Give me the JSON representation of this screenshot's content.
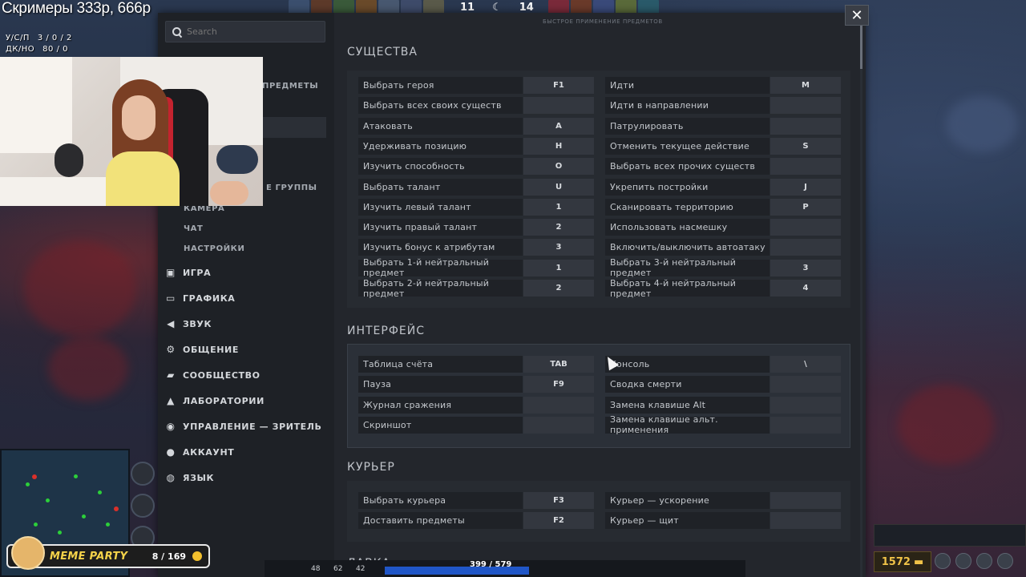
{
  "stream": {
    "title": "Скримеры 333р, 666р",
    "kda_label": "У/С/П",
    "kda_value": "3 / 0 / 2",
    "lhdn_label": "ДК/НО",
    "lhdn_value": "80 / 0"
  },
  "top_hud": {
    "radiant_score": "11",
    "dire_score": "14"
  },
  "settings": {
    "search_placeholder": "Search",
    "sidebar_sub": {
      "items_partial": "ПРЕДМЕТЫ",
      "groups_partial": "Е ГРУППЫ",
      "camera": "КАМЕРА",
      "chat": "ЧАТ",
      "settings": "НАСТРОЙКИ"
    },
    "nav": [
      {
        "label": "ИГРА",
        "icon": "game-icon"
      },
      {
        "label": "ГРАФИКА",
        "icon": "monitor-icon"
      },
      {
        "label": "ЗВУК",
        "icon": "speaker-icon"
      },
      {
        "label": "ОБЩЕНИЕ",
        "icon": "gear-icon"
      },
      {
        "label": "СООБЩЕСТВО",
        "icon": "chat-bubble-icon"
      },
      {
        "label": "ЛАБОРАТОРИИ",
        "icon": "flask-icon"
      },
      {
        "label": "УПРАВЛЕНИЕ — ЗРИТЕЛЬ",
        "icon": "eye-icon"
      },
      {
        "label": "АККАУНТ",
        "icon": "user-icon"
      },
      {
        "label": "ЯЗЫК",
        "icon": "globe-icon"
      }
    ],
    "top_caption": "БЫСТРОЕ ПРИМЕНЕНИЕ ПРЕДМЕТОВ",
    "sections": {
      "units": {
        "title": "СУЩЕСТВА",
        "left": [
          {
            "label": "Выбрать героя",
            "key": "F1"
          },
          {
            "label": "Выбрать всех своих существ",
            "key": ""
          },
          {
            "label": "Атаковать",
            "key": "A"
          },
          {
            "label": "Удерживать позицию",
            "key": "H"
          },
          {
            "label": "Изучить способность",
            "key": "O"
          },
          {
            "label": "Выбрать талант",
            "key": "U"
          },
          {
            "label": "Изучить левый талант",
            "key": "1"
          },
          {
            "label": "Изучить правый талант",
            "key": "2"
          },
          {
            "label": "Изучить бонус к атрибутам",
            "key": "3"
          },
          {
            "label": "Выбрать 1-й нейтральный предмет",
            "key": "1"
          },
          {
            "label": "Выбрать 2-й нейтральный предмет",
            "key": "2"
          }
        ],
        "right": [
          {
            "label": "Идти",
            "key": "M"
          },
          {
            "label": "Идти в направлении",
            "key": ""
          },
          {
            "label": "Патрулировать",
            "key": ""
          },
          {
            "label": "Отменить текущее действие",
            "key": "S"
          },
          {
            "label": "Выбрать всех прочих существ",
            "key": ""
          },
          {
            "label": "Укрепить постройки",
            "key": "J"
          },
          {
            "label": "Сканировать территорию",
            "key": "P"
          },
          {
            "label": "Использовать насмешку",
            "key": ""
          },
          {
            "label": "Включить/выключить автоатаку",
            "key": ""
          },
          {
            "label": "Выбрать 3-й нейтральный предмет",
            "key": "3"
          },
          {
            "label": "Выбрать 4-й нейтральный предмет",
            "key": "4"
          }
        ]
      },
      "interface": {
        "title": "ИНТЕРФЕЙС",
        "left": [
          {
            "label": "Таблица счёта",
            "key": "TAB"
          },
          {
            "label": "Пауза",
            "key": "F9"
          },
          {
            "label": "Журнал сражения",
            "key": ""
          },
          {
            "label": "Скриншот",
            "key": ""
          }
        ],
        "right": [
          {
            "label": "Консоль",
            "key": "\\"
          },
          {
            "label": "Сводка смерти",
            "key": ""
          },
          {
            "label": "Замена клавише Alt",
            "key": ""
          },
          {
            "label": "Замена клавише альт. применения",
            "key": ""
          }
        ]
      },
      "courier": {
        "title": "КУРЬЕР",
        "left": [
          {
            "label": "Выбрать курьера",
            "key": "F3"
          },
          {
            "label": "Доставить предметы",
            "key": "F2"
          }
        ],
        "right": [
          {
            "label": "Курьер — ускорение",
            "key": ""
          },
          {
            "label": "Курьер — щит",
            "key": ""
          }
        ]
      },
      "shop": {
        "title": "ЛАВКА"
      }
    },
    "close_label": "✕"
  },
  "bottom_hud": {
    "meme_party_title": "MEME PARTY",
    "meme_party_count": "8 / 169",
    "hp_text": "399 / 579",
    "stats": [
      "48",
      "62",
      "42"
    ],
    "gold": "1572"
  }
}
